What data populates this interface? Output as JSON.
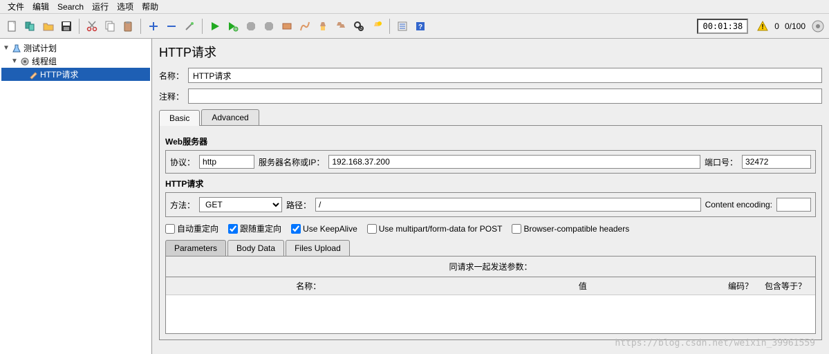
{
  "menu": {
    "file": "文件",
    "edit": "编辑",
    "search": "Search",
    "run": "运行",
    "options": "选项",
    "help": "帮助"
  },
  "toolbar": {
    "time": "00:01:38",
    "warn_count": "0",
    "ratio": "0/100"
  },
  "tree": {
    "plan": "测试计划",
    "group": "线程组",
    "http": "HTTP请求"
  },
  "panel": {
    "title": "HTTP请求",
    "name_label": "名称：",
    "name_value": "HTTP请求",
    "comment_label": "注释：",
    "comment_value": "",
    "tab_basic": "Basic",
    "tab_advanced": "Advanced",
    "web_server_title": "Web服务器",
    "protocol_label": "协议：",
    "protocol_value": "http",
    "server_label": "服务器名称或IP：",
    "server_value": "192.168.37.200",
    "port_label": "端口号：",
    "port_value": "32472",
    "http_req_title": "HTTP请求",
    "method_label": "方法：",
    "method_value": "GET",
    "path_label": "路径：",
    "path_value": "/",
    "encoding_label": "Content encoding:",
    "encoding_value": "",
    "chk_auto": "自动重定向",
    "chk_follow": "跟随重定向",
    "chk_keepalive": "Use KeepAlive",
    "chk_multipart": "Use multipart/form-data for POST",
    "chk_browser": "Browser-compatible headers",
    "subtab_params": "Parameters",
    "subtab_body": "Body Data",
    "subtab_files": "Files Upload",
    "params_title": "同请求一起发送参数：",
    "col_name": "名称：",
    "col_value": "值",
    "col_encode": "编码？",
    "col_include": "包含等于？"
  },
  "watermark": "https://blog.csdn.net/weixin_39961559"
}
